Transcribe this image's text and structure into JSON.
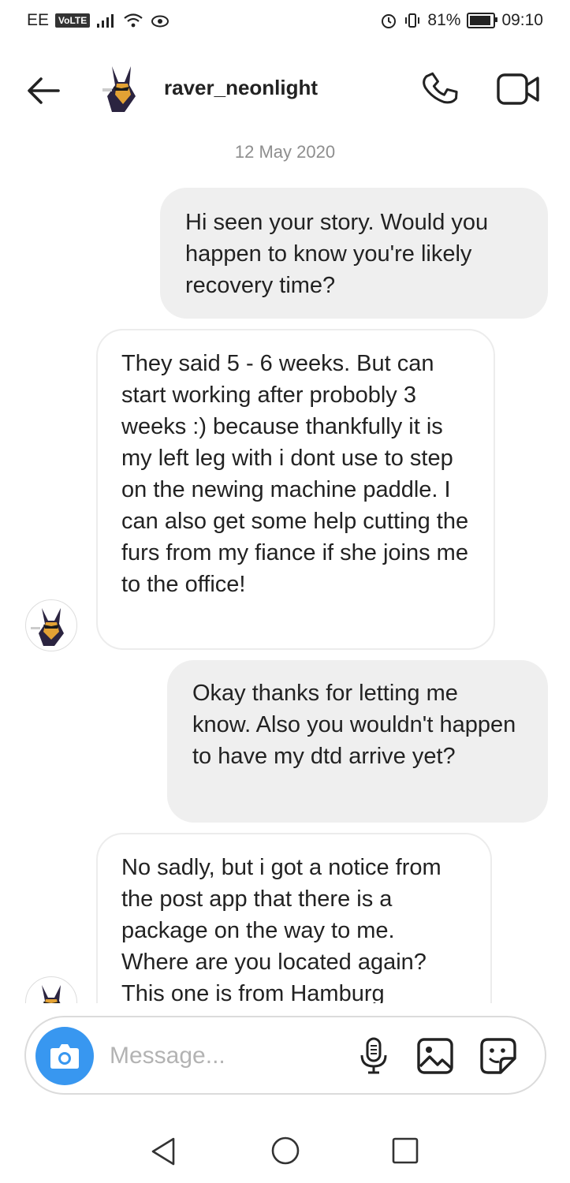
{
  "status_bar": {
    "carrier": "EE",
    "volte": "VoLTE",
    "battery_percent": "81%",
    "battery_level": 0.81,
    "time": "09:10"
  },
  "header": {
    "username": "raver_neonlight",
    "back_icon": "arrow-left-icon",
    "call_icon": "phone-icon",
    "video_icon": "video-camera-icon"
  },
  "date_label": "12 May 2020",
  "messages": [
    {
      "direction": "sent",
      "text": "Hi seen your story. Would you happen to know you're likely recovery time?"
    },
    {
      "direction": "received",
      "text": "They said 5 - 6 weeks. But can start working after probobly 3 weeks :) because thankfully it is my left leg with i dont use to step on the newing machine paddle. I can also get some help cutting the furs from my fiance if she joins me to the office!"
    },
    {
      "direction": "sent",
      "text": "Okay thanks for letting me know. Also you wouldn't happen to have my dtd arrive yet?"
    },
    {
      "direction": "received",
      "text": "No sadly, but i got a notice from the post app that there is a package on the way to me. Where are you located again? This one is from Hamburg"
    }
  ],
  "composer": {
    "placeholder": "Message...",
    "value": "",
    "icons": [
      "camera-icon",
      "microphone-icon",
      "gallery-icon",
      "sticker-icon"
    ]
  },
  "nav_bar": {
    "icons": [
      "nav-back-icon",
      "nav-home-icon",
      "nav-recents-icon"
    ]
  },
  "colors": {
    "accent": "#3897f0",
    "sent_bubble": "#efefef",
    "received_border": "#ececec",
    "date_text": "#8e8e8e"
  }
}
